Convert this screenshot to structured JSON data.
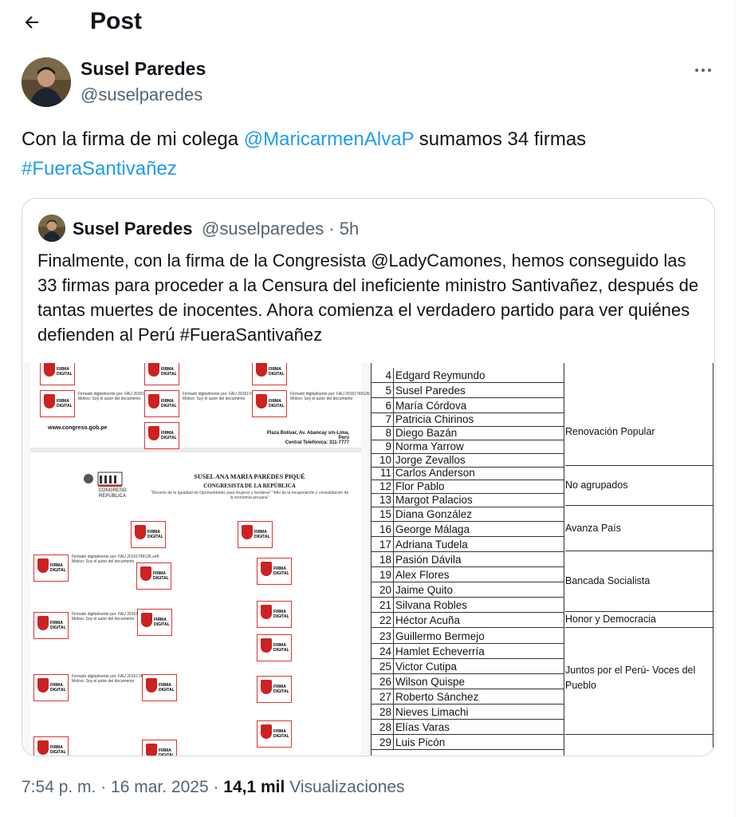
{
  "header": {
    "title": "Post"
  },
  "author": {
    "name": "Susel Paredes",
    "handle": "@suselparedes"
  },
  "tweet": {
    "part1": "Con la firma de mi colega ",
    "mention": "@MaricarmenAlvaP",
    "part2": " sumamos 34 firmas",
    "hashtag": "#FueraSantivañez"
  },
  "quote": {
    "name": "Susel Paredes",
    "handle_time": "@suselparedes · 5h",
    "text": "Finalmente, con la firma de la Congresista @LadyCamones, hemos conseguido las 33 firmas para proceder a la Censura del ineficiente ministro Santivañez, después de tantas muertes de inocentes. Ahora comienza el verdadero partido para ver quiénes defienden al Perú #FueraSantivañez"
  },
  "document": {
    "website": "www.congreso.gob.pe",
    "address": "Plaza Bolívar, Av. Abancay s/n-Lima, Perú",
    "phone": "Central Telefónica: 311-7777",
    "name": "SUSEL ANA MARIA PAREDES PIQUÉ",
    "chamber": "CONGRESISTA DE LA REPÚBLICA",
    "subtitle": "\"Decenio de la Igualdad de Oportunidades para mujeres y hombres\" \"Año de la recuperación y consolidación de la economía peruana\"",
    "logo_text": "CONGRESO REPÚBLICA",
    "stamp_label": "FIRMA DIGITAL",
    "stamp_caption": "Firmado digitalmente por: FAU 20161749126 soft Motivo: Soy el autor del documento"
  },
  "table": {
    "rows": [
      {
        "n": "4",
        "name": "Edgard Reymundo"
      },
      {
        "n": "5",
        "name": "Susel Paredes"
      },
      {
        "n": "6",
        "name": "María Córdova"
      },
      {
        "n": "7",
        "name": "Patricia Chirinos"
      },
      {
        "n": "8",
        "name": "Diego Bazán"
      },
      {
        "n": "9",
        "name": "Norma Yarrow"
      },
      {
        "n": "10",
        "name": "Jorge Zevallos"
      },
      {
        "n": "11",
        "name": "Carlos Anderson"
      },
      {
        "n": "12",
        "name": "Flor Pablo"
      },
      {
        "n": "13",
        "name": "Margot Palacios"
      },
      {
        "n": "15",
        "name": "Diana González"
      },
      {
        "n": "16",
        "name": "George Málaga"
      },
      {
        "n": "17",
        "name": "Adriana Tudela"
      },
      {
        "n": "18",
        "name": "Pasión Dávila"
      },
      {
        "n": "19",
        "name": "Alex Flores"
      },
      {
        "n": "20",
        "name": "Jaime Quito"
      },
      {
        "n": "21",
        "name": "Silvana Robles"
      },
      {
        "n": "22",
        "name": "Héctor Acuña"
      },
      {
        "n": "23",
        "name": "Guillermo Bermejo"
      },
      {
        "n": "24",
        "name": "Hamlet Echeverría"
      },
      {
        "n": "25",
        "name": "Victor Cutipa"
      },
      {
        "n": "26",
        "name": "Wilson Quispe"
      },
      {
        "n": "27",
        "name": "Roberto Sánchez"
      },
      {
        "n": "28",
        "name": "Nieves Limachi"
      },
      {
        "n": "28",
        "name": "Elías Varas"
      },
      {
        "n": "29",
        "name": "Luis Picón"
      }
    ],
    "groups": [
      {
        "label": "Renovación Popular"
      },
      {
        "label": "No agrupados"
      },
      {
        "label": "Avanza País"
      },
      {
        "label": "Bancada Socialista"
      },
      {
        "label": "Honor y Democracia"
      },
      {
        "label": "Juntos por el Perú- Voces del Pueblo"
      }
    ]
  },
  "meta": {
    "time": "7:54 p. m. · 16 mar. 2025 · ",
    "views_count": "14,1 mil",
    "views_label": " Visualizaciones"
  }
}
